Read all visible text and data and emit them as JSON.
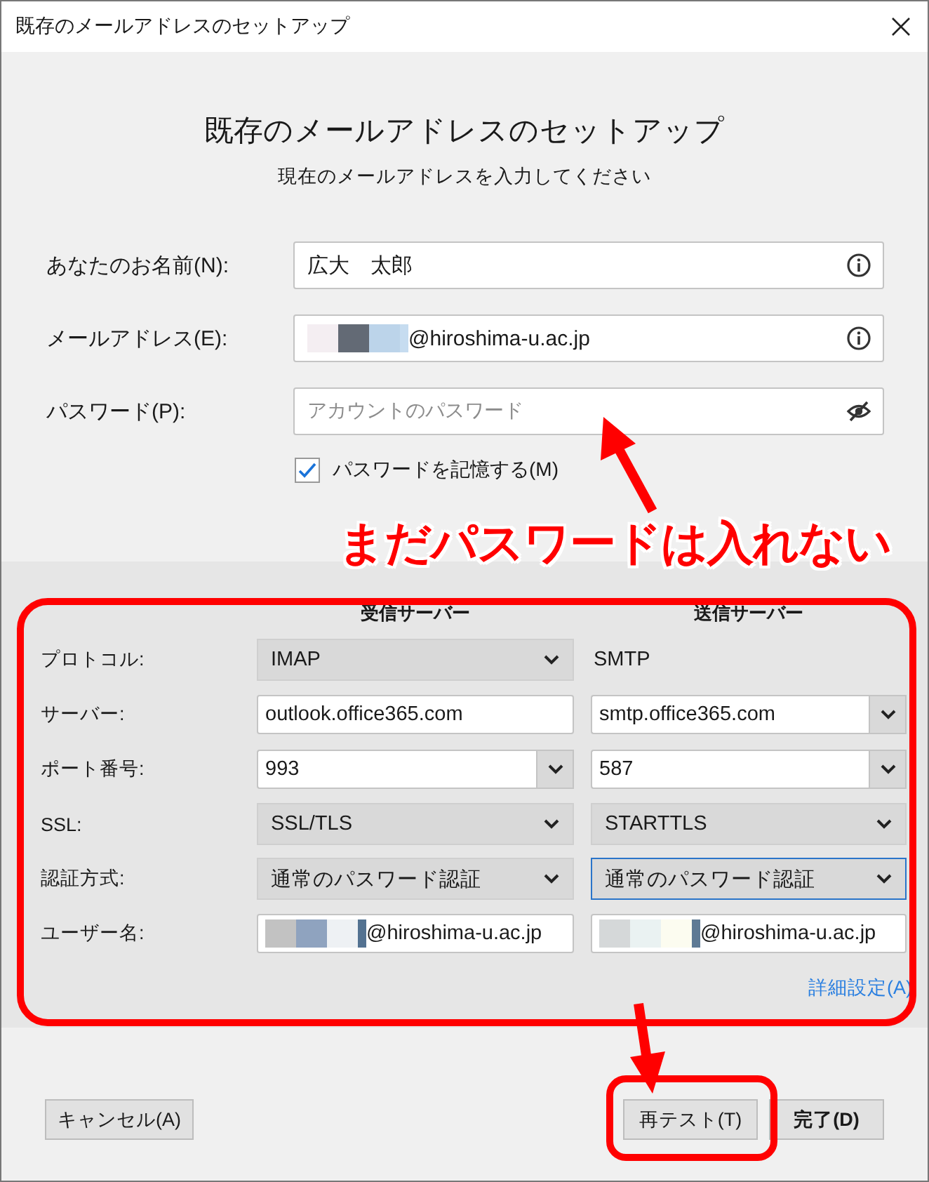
{
  "window": {
    "title": "既存のメールアドレスのセットアップ"
  },
  "heading": "既存のメールアドレスのセットアップ",
  "subheading": "現在のメールアドレスを入力してください",
  "fields": [
    {
      "label": "あなたのお名前(N):",
      "value": "広大　太郎",
      "kind": "text"
    },
    {
      "label": "メールアドレス(E):",
      "value": "@hiroshima-u.ac.jp",
      "kind": "redacted"
    },
    {
      "label": "パスワード(P):",
      "placeholder": "アカウントのパスワード",
      "kind": "password"
    }
  ],
  "remember_password": {
    "label": "パスワードを記憶する(M)",
    "checked": true
  },
  "server_settings": {
    "columns": [
      "受信サーバー",
      "送信サーバー"
    ],
    "rows": [
      {
        "label": "プロトコル:",
        "incoming": {
          "kind": "select",
          "value": "IMAP",
          "focused": false
        },
        "outgoing": {
          "kind": "static",
          "value": "SMTP"
        }
      },
      {
        "label": "サーバー:",
        "incoming": {
          "kind": "text",
          "value": "outlook.office365.com"
        },
        "outgoing": {
          "kind": "combo",
          "value": "smtp.office365.com"
        }
      },
      {
        "label": "ポート番号:",
        "incoming": {
          "kind": "combo",
          "value": "993"
        },
        "outgoing": {
          "kind": "combo",
          "value": "587"
        }
      },
      {
        "label": "SSL:",
        "incoming": {
          "kind": "select",
          "value": "SSL/TLS",
          "focused": false
        },
        "outgoing": {
          "kind": "select",
          "value": "STARTTLS",
          "focused": false
        }
      },
      {
        "label": "認証方式:",
        "incoming": {
          "kind": "select",
          "value": "通常のパスワード認証",
          "focused": false
        },
        "outgoing": {
          "kind": "select",
          "value": "通常のパスワード認証",
          "focused": true
        }
      },
      {
        "label": "ユーザー名:",
        "incoming": {
          "kind": "redacted",
          "value": "@hiroshima-u.ac.jp"
        },
        "outgoing": {
          "kind": "redacted",
          "value": "@hiroshima-u.ac.jp"
        }
      }
    ],
    "advanced_link": "詳細設定(A)"
  },
  "buttons": [
    {
      "label": "キャンセル(A)",
      "kind": "cancel"
    },
    {
      "label": "再テスト(T)",
      "kind": "normal"
    },
    {
      "label": "完了(D)",
      "kind": "default"
    }
  ],
  "annotation": {
    "callout": "まだパスワードは入れない"
  }
}
